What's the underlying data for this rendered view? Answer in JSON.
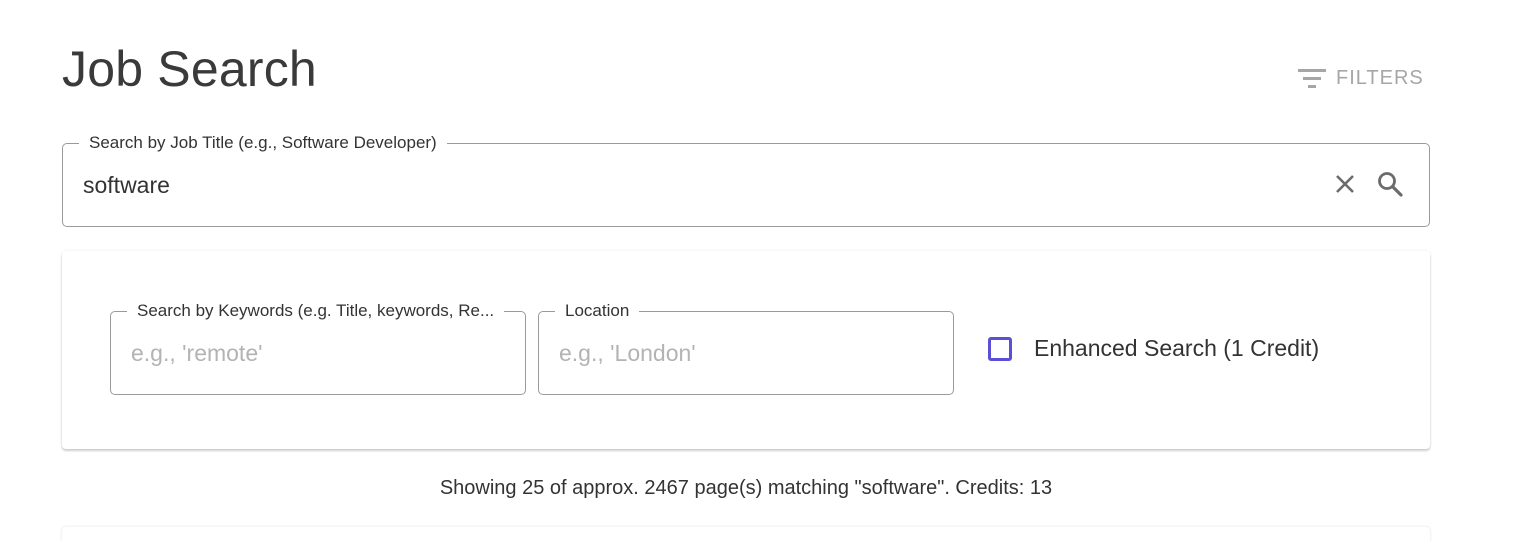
{
  "header": {
    "title": "Job Search",
    "filters_label": "FILTERS"
  },
  "main_search": {
    "label": "Search by Job Title (e.g., Software Developer)",
    "value": "software"
  },
  "advanced": {
    "keywords": {
      "label": "Search by Keywords (e.g. Title, keywords, Re...",
      "placeholder": "e.g., 'remote'",
      "value": ""
    },
    "location": {
      "label": "Location",
      "placeholder": "e.g., 'London'",
      "value": ""
    },
    "enhanced_search": {
      "label": "Enhanced Search (1 Credit)",
      "checked": false
    }
  },
  "status": {
    "text": "Showing 25 of approx. 2467 page(s) matching \"software\". Credits: 13"
  },
  "colors": {
    "accent": "#5b4fd6",
    "muted": "#a6a6a6",
    "border": "#9a9a9a"
  },
  "icons": {
    "filters": "filter-list-icon",
    "clear": "close-icon",
    "search": "search-icon"
  }
}
